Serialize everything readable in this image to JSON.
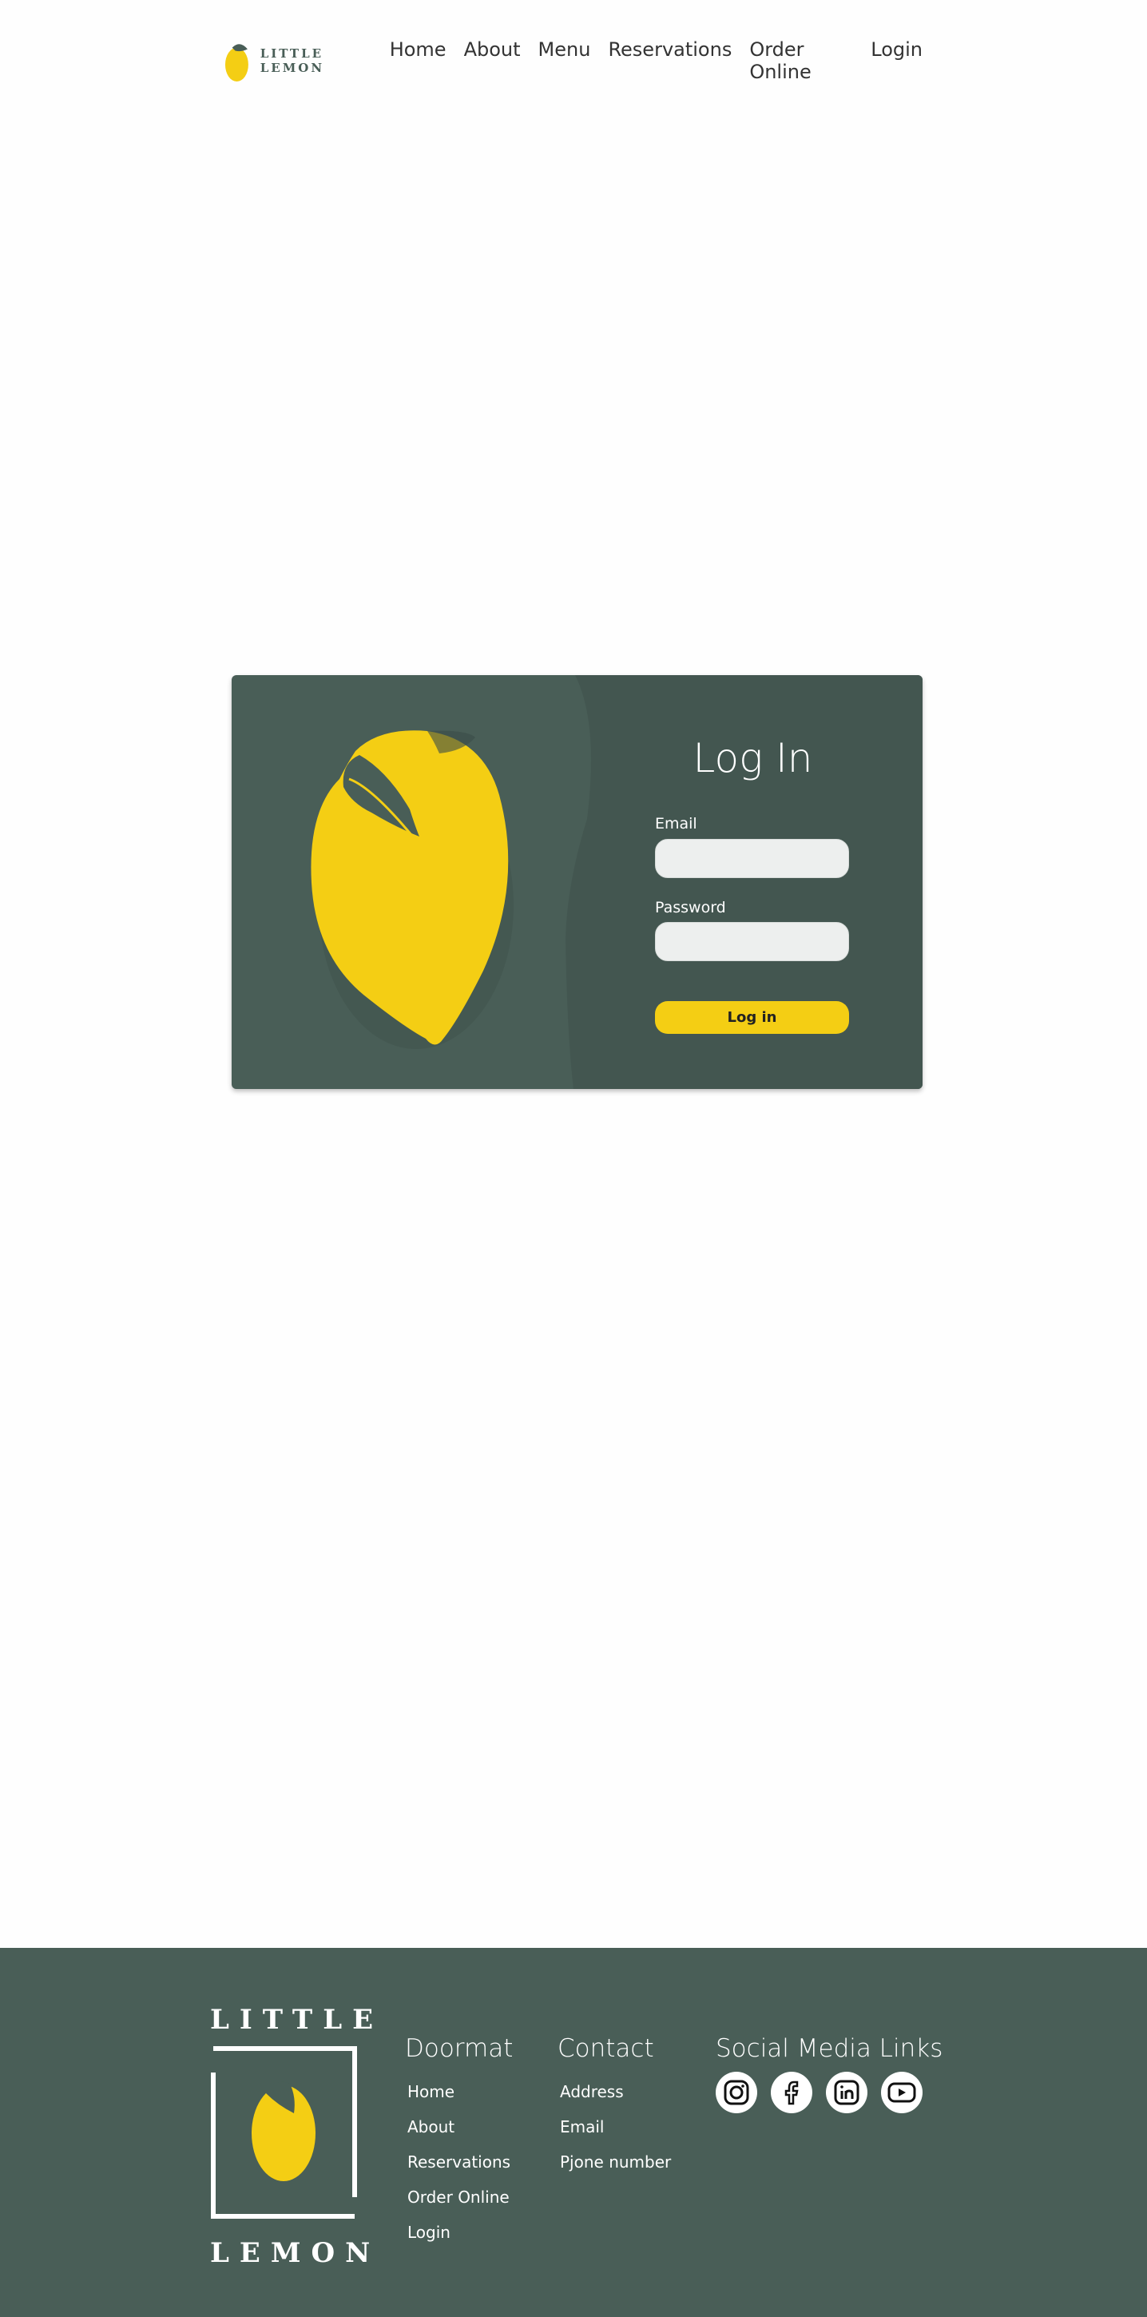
{
  "nav": {
    "logo_text": "LITTLE LEMON",
    "links": [
      "Home",
      "About",
      "Menu",
      "Reservations",
      "Order Online",
      "Login"
    ]
  },
  "login": {
    "title": "Log In",
    "email_label": "Email",
    "email_value": "",
    "password_label": "Password",
    "password_value": "",
    "button_label": "Log in"
  },
  "footer": {
    "logo_top": "LITTLE",
    "logo_bottom": "LEMON",
    "doormat": {
      "title": "Doormat",
      "links": [
        "Home",
        "About",
        "Reservations",
        "Order Online",
        "Login"
      ]
    },
    "contact": {
      "title": "Contact",
      "links": [
        "Address",
        "Email",
        "Pjone number"
      ]
    },
    "social": {
      "title": "Social Media Links",
      "icons": [
        "instagram-icon",
        "facebook-icon",
        "linkedin-icon",
        "youtube-icon"
      ]
    }
  },
  "colors": {
    "primary_green": "#495e57",
    "lemon_yellow": "#f4ce14",
    "input_bg": "#edefee"
  }
}
